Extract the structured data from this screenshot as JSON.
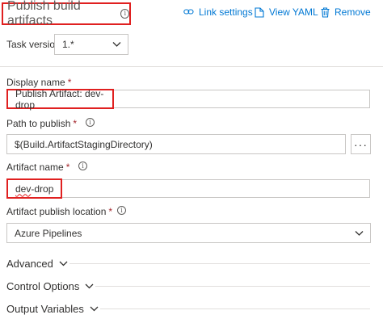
{
  "header": {
    "title": "Publish build artifacts",
    "link_settings": "Link settings",
    "view_yaml": "View YAML",
    "remove": "Remove"
  },
  "task_version": {
    "label": "Task version",
    "value": "1.*"
  },
  "display_name": {
    "label": "Display name",
    "required": "*",
    "value": "Publish Artifact: dev-drop"
  },
  "path_to_publish": {
    "label": "Path to publish",
    "required": "*",
    "value": "$(Build.ArtifactStagingDirectory)",
    "more": "···"
  },
  "artifact_name": {
    "label": "Artifact name",
    "required": "*",
    "value_underlined": "dev",
    "value_rest": "-drop"
  },
  "publish_location": {
    "label": "Artifact publish location",
    "required": "*",
    "value": "Azure Pipelines"
  },
  "sections": {
    "advanced": "Advanced",
    "control_options": "Control Options",
    "output_variables": "Output Variables"
  },
  "colors": {
    "accent": "#0078d4",
    "highlight": "#e02020",
    "required": "#a4262c"
  },
  "icons": [
    "info-icon",
    "link-icon",
    "yaml-icon",
    "trash-icon",
    "chevron-down-icon",
    "more-icon"
  ]
}
